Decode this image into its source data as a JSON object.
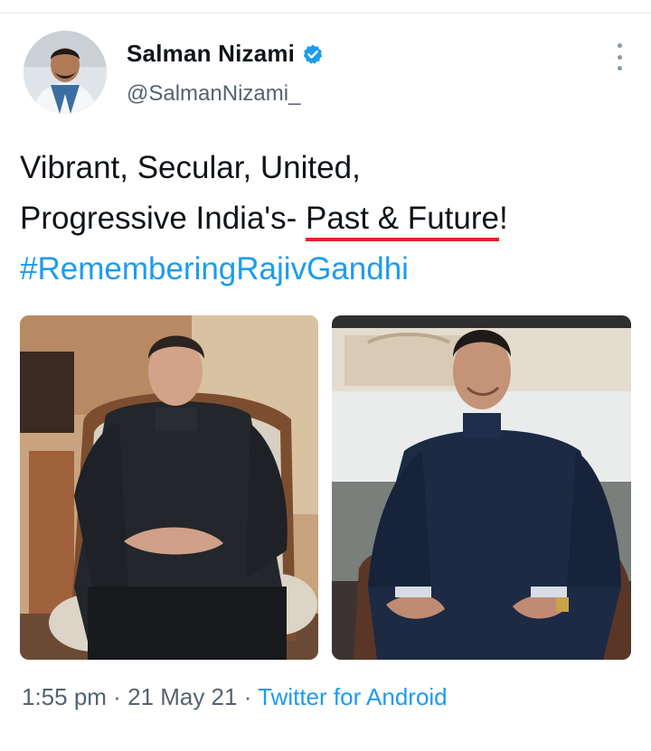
{
  "author": {
    "display_name": "Salman Nizami",
    "handle": "@SalmanNizami_",
    "verified": true
  },
  "tweet": {
    "line1": "Vibrant, Secular, United,",
    "line2_prefix": "Progressive India's- ",
    "line2_highlight": "Past & Future",
    "line2_suffix": "!",
    "hashtag": "#RememberingRajivGandhi"
  },
  "media": {
    "photo_count": 2
  },
  "meta": {
    "time": "1:55 pm",
    "separator": " · ",
    "date": "21 May 21",
    "source": "Twitter for Android"
  },
  "colors": {
    "link": "#1d9bf0",
    "verified": "#1d9bf0",
    "underline": "#e0262b",
    "muted": "#536471"
  },
  "icons": [
    "verified-badge-icon",
    "more-options-icon"
  ]
}
